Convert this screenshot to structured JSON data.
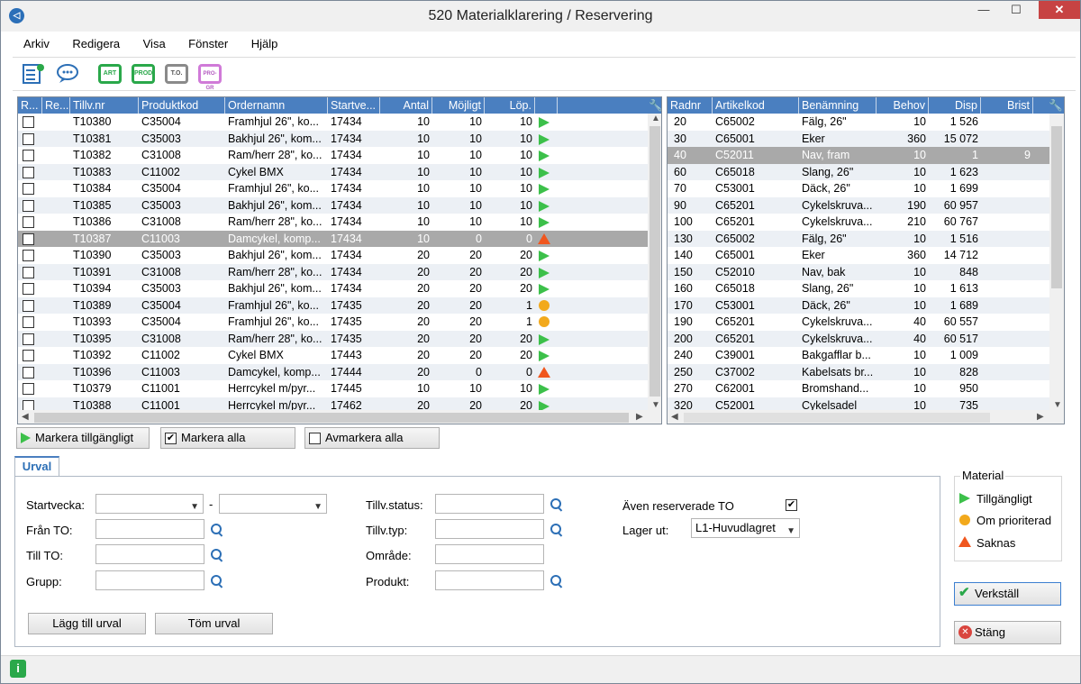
{
  "window": {
    "title": "520 Materialklarering / Reservering",
    "min": "—",
    "max": "☐",
    "close": "✕"
  },
  "menu": [
    "Arkiv",
    "Redigera",
    "Visa",
    "Fönster",
    "Hjälp"
  ],
  "toolbar": {
    "btn_art": "ART",
    "btn_prod": "PROD",
    "btn_to": "T.O.",
    "btn_progr": "PRO-GR"
  },
  "left_grid": {
    "headers": [
      "R...",
      "Re...",
      "Tillv.nr",
      "Produktkod",
      "Ordernamn",
      "Startve...",
      "Antal",
      "Möjligt",
      "Löp."
    ],
    "rows": [
      {
        "tillv": "T10380",
        "prod": "C35004",
        "order": "Framhjul 26\", ko...",
        "start": "17434",
        "antal": "10",
        "mojligt": "10",
        "lop": "10",
        "status": "ok"
      },
      {
        "tillv": "T10381",
        "prod": "C35003",
        "order": "Bakhjul 26\", kom...",
        "start": "17434",
        "antal": "10",
        "mojligt": "10",
        "lop": "10",
        "status": "ok"
      },
      {
        "tillv": "T10382",
        "prod": "C31008",
        "order": "Ram/herr 28\", ko...",
        "start": "17434",
        "antal": "10",
        "mojligt": "10",
        "lop": "10",
        "status": "ok"
      },
      {
        "tillv": "T10383",
        "prod": "C11002",
        "order": "Cykel BMX",
        "start": "17434",
        "antal": "10",
        "mojligt": "10",
        "lop": "10",
        "status": "ok"
      },
      {
        "tillv": "T10384",
        "prod": "C35004",
        "order": "Framhjul 26\", ko...",
        "start": "17434",
        "antal": "10",
        "mojligt": "10",
        "lop": "10",
        "status": "ok"
      },
      {
        "tillv": "T10385",
        "prod": "C35003",
        "order": "Bakhjul 26\", kom...",
        "start": "17434",
        "antal": "10",
        "mojligt": "10",
        "lop": "10",
        "status": "ok"
      },
      {
        "tillv": "T10386",
        "prod": "C31008",
        "order": "Ram/herr 28\", ko...",
        "start": "17434",
        "antal": "10",
        "mojligt": "10",
        "lop": "10",
        "status": "ok"
      },
      {
        "tillv": "T10387",
        "prod": "C11003",
        "order": "Damcykel, komp...",
        "start": "17434",
        "antal": "10",
        "mojligt": "0",
        "lop": "0",
        "status": "missing"
      },
      {
        "tillv": "T10390",
        "prod": "C35003",
        "order": "Bakhjul 26\", kom...",
        "start": "17434",
        "antal": "20",
        "mojligt": "20",
        "lop": "20",
        "status": "ok"
      },
      {
        "tillv": "T10391",
        "prod": "C31008",
        "order": "Ram/herr 28\", ko...",
        "start": "17434",
        "antal": "20",
        "mojligt": "20",
        "lop": "20",
        "status": "ok"
      },
      {
        "tillv": "T10394",
        "prod": "C35003",
        "order": "Bakhjul 26\", kom...",
        "start": "17434",
        "antal": "20",
        "mojligt": "20",
        "lop": "20",
        "status": "ok"
      },
      {
        "tillv": "T10389",
        "prod": "C35004",
        "order": "Framhjul 26\", ko...",
        "start": "17435",
        "antal": "20",
        "mojligt": "20",
        "lop": "1",
        "status": "priority"
      },
      {
        "tillv": "T10393",
        "prod": "C35004",
        "order": "Framhjul 26\", ko...",
        "start": "17435",
        "antal": "20",
        "mojligt": "20",
        "lop": "1",
        "status": "priority"
      },
      {
        "tillv": "T10395",
        "prod": "C31008",
        "order": "Ram/herr 28\", ko...",
        "start": "17435",
        "antal": "20",
        "mojligt": "20",
        "lop": "20",
        "status": "ok"
      },
      {
        "tillv": "T10392",
        "prod": "C11002",
        "order": "Cykel BMX",
        "start": "17443",
        "antal": "20",
        "mojligt": "20",
        "lop": "20",
        "status": "ok"
      },
      {
        "tillv": "T10396",
        "prod": "C11003",
        "order": "Damcykel, komp...",
        "start": "17444",
        "antal": "20",
        "mojligt": "0",
        "lop": "0",
        "status": "missing"
      },
      {
        "tillv": "T10379",
        "prod": "C11001",
        "order": "Herrcykel m/pyr...",
        "start": "17445",
        "antal": "10",
        "mojligt": "10",
        "lop": "10",
        "status": "ok"
      },
      {
        "tillv": "T10388",
        "prod": "C11001",
        "order": "Herrcykel m/pyr...",
        "start": "17462",
        "antal": "20",
        "mojligt": "20",
        "lop": "20",
        "status": "ok"
      }
    ],
    "selected_index": 7
  },
  "right_grid": {
    "headers": [
      "Radnr",
      "Artikelkod",
      "Benämning",
      "Behov",
      "Disp",
      "Brist"
    ],
    "rows": [
      {
        "radnr": "20",
        "art": "C65002",
        "ben": "Fälg, 26\"",
        "behov": "10",
        "disp": "1 526",
        "brist": ""
      },
      {
        "radnr": "30",
        "art": "C65001",
        "ben": "Eker",
        "behov": "360",
        "disp": "15 072",
        "brist": ""
      },
      {
        "radnr": "40",
        "art": "C52011",
        "ben": "Nav, fram",
        "behov": "10",
        "disp": "1",
        "brist": "9"
      },
      {
        "radnr": "60",
        "art": "C65018",
        "ben": "Slang, 26\"",
        "behov": "10",
        "disp": "1 623",
        "brist": ""
      },
      {
        "radnr": "70",
        "art": "C53001",
        "ben": "Däck, 26\"",
        "behov": "10",
        "disp": "1 699",
        "brist": ""
      },
      {
        "radnr": "90",
        "art": "C65201",
        "ben": "Cykelskruva...",
        "behov": "190",
        "disp": "60 957",
        "brist": ""
      },
      {
        "radnr": "100",
        "art": "C65201",
        "ben": "Cykelskruva...",
        "behov": "210",
        "disp": "60 767",
        "brist": ""
      },
      {
        "radnr": "130",
        "art": "C65002",
        "ben": "Fälg, 26\"",
        "behov": "10",
        "disp": "1 516",
        "brist": ""
      },
      {
        "radnr": "140",
        "art": "C65001",
        "ben": "Eker",
        "behov": "360",
        "disp": "14 712",
        "brist": ""
      },
      {
        "radnr": "150",
        "art": "C52010",
        "ben": "Nav, bak",
        "behov": "10",
        "disp": "848",
        "brist": ""
      },
      {
        "radnr": "160",
        "art": "C65018",
        "ben": "Slang, 26\"",
        "behov": "10",
        "disp": "1 613",
        "brist": ""
      },
      {
        "radnr": "170",
        "art": "C53001",
        "ben": "Däck, 26\"",
        "behov": "10",
        "disp": "1 689",
        "brist": ""
      },
      {
        "radnr": "190",
        "art": "C65201",
        "ben": "Cykelskruva...",
        "behov": "40",
        "disp": "60 557",
        "brist": ""
      },
      {
        "radnr": "200",
        "art": "C65201",
        "ben": "Cykelskruva...",
        "behov": "40",
        "disp": "60 517",
        "brist": ""
      },
      {
        "radnr": "240",
        "art": "C39001",
        "ben": "Bakgafflar b...",
        "behov": "10",
        "disp": "1 009",
        "brist": ""
      },
      {
        "radnr": "250",
        "art": "C37002",
        "ben": "Kabelsats br...",
        "behov": "10",
        "disp": "828",
        "brist": ""
      },
      {
        "radnr": "270",
        "art": "C62001",
        "ben": "Bromshand...",
        "behov": "10",
        "disp": "950",
        "brist": ""
      },
      {
        "radnr": "320",
        "art": "C52001",
        "ben": "Cykelsadel",
        "behov": "10",
        "disp": "735",
        "brist": ""
      }
    ],
    "selected_index": 2
  },
  "mark_buttons": {
    "available": "Markera tillgängligt",
    "all": "Markera alla",
    "none": "Avmarkera alla"
  },
  "tab": "Urval",
  "filters": {
    "startvecka": "Startvecka:",
    "dash": "-",
    "fran_to": "Från TO:",
    "till_to": "Till TO:",
    "grupp": "Grupp:",
    "tillv_status": "Tillv.status:",
    "tillv_typ": "Tillv.typ:",
    "omrade": "Område:",
    "produkt": "Produkt:",
    "aven_res": "Även reserverade TO",
    "lager_ut": "Lager ut:",
    "lager_value": "L1-Huvudlagret",
    "add_btn": "Lägg till urval",
    "clear_btn": "Töm urval"
  },
  "legend": {
    "title": "Material",
    "ok": "Tillgängligt",
    "priority": "Om prioriterad",
    "missing": "Saknas"
  },
  "actions": {
    "apply": "Verkställ",
    "close": "Stäng"
  },
  "colors": {
    "header": "#4a7fc0",
    "ok": "#3cc04a",
    "priority": "#f2a91c",
    "missing": "#f0561e",
    "selected": "#a9a9a9"
  }
}
